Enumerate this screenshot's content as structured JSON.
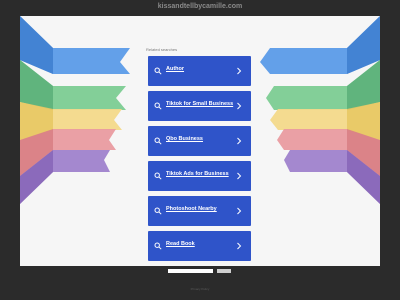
{
  "site": {
    "domain": "kissandtellbycamille.com"
  },
  "related": {
    "heading": "Related searches",
    "links": [
      {
        "label": "Author"
      },
      {
        "label": "Tiktok for Small Business"
      },
      {
        "label": "Qbo Business"
      },
      {
        "label": "Tiktok Ads for Business"
      },
      {
        "label": "Photoshoot Nearby"
      },
      {
        "label": "Read Book"
      }
    ]
  },
  "search": {
    "placeholder": "",
    "button_label": ""
  },
  "footer": {
    "text": "Privacy Policy"
  },
  "colors": {
    "page_background": "#2b2b2b",
    "panel_background": "#f6f6f6",
    "link_card": "#2f54c9",
    "ribbons": [
      "#4a90e2",
      "#6cc28a",
      "#f4d27a",
      "#e58f93",
      "#9a76c8"
    ]
  }
}
